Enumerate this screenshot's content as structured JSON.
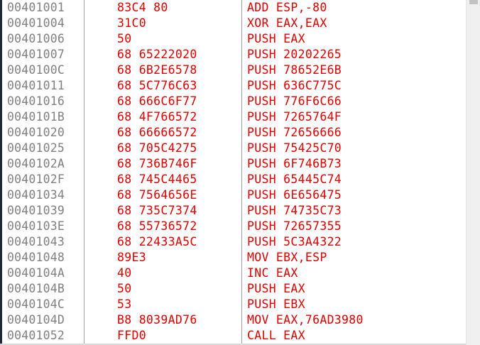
{
  "disassembly": {
    "colors": {
      "address": "#808080",
      "instruction": "#e00000",
      "separator": "#a0a0a0"
    },
    "rows": [
      {
        "address": "00401001",
        "bytes": "83C4 80",
        "instruction": "ADD ESP,-80"
      },
      {
        "address": "00401004",
        "bytes": "31C0",
        "instruction": "XOR EAX,EAX"
      },
      {
        "address": "00401006",
        "bytes": "50",
        "instruction": "PUSH EAX"
      },
      {
        "address": "00401007",
        "bytes": "68 65222020",
        "instruction": "PUSH 20202265"
      },
      {
        "address": "0040100C",
        "bytes": "68 6B2E6578",
        "instruction": "PUSH 78652E6B"
      },
      {
        "address": "00401011",
        "bytes": "68 5C776C63",
        "instruction": "PUSH 636C775C"
      },
      {
        "address": "00401016",
        "bytes": "68 666C6F77",
        "instruction": "PUSH 776F6C66"
      },
      {
        "address": "0040101B",
        "bytes": "68 4F766572",
        "instruction": "PUSH 7265764F"
      },
      {
        "address": "00401020",
        "bytes": "68 66666572",
        "instruction": "PUSH 72656666"
      },
      {
        "address": "00401025",
        "bytes": "68 705C4275",
        "instruction": "PUSH 75425C70"
      },
      {
        "address": "0040102A",
        "bytes": "68 736B746F",
        "instruction": "PUSH 6F746B73"
      },
      {
        "address": "0040102F",
        "bytes": "68 745C4465",
        "instruction": "PUSH 65445C74"
      },
      {
        "address": "00401034",
        "bytes": "68 7564656E",
        "instruction": "PUSH 6E656475"
      },
      {
        "address": "00401039",
        "bytes": "68 735C7374",
        "instruction": "PUSH 74735C73"
      },
      {
        "address": "0040103E",
        "bytes": "68 55736572",
        "instruction": "PUSH 72657355"
      },
      {
        "address": "00401043",
        "bytes": "68 22433A5C",
        "instruction": "PUSH 5C3A4322"
      },
      {
        "address": "00401048",
        "bytes": "89E3",
        "instruction": "MOV EBX,ESP"
      },
      {
        "address": "0040104A",
        "bytes": "40",
        "instruction": "INC EAX"
      },
      {
        "address": "0040104B",
        "bytes": "50",
        "instruction": "PUSH EAX"
      },
      {
        "address": "0040104C",
        "bytes": "53",
        "instruction": "PUSH EBX"
      },
      {
        "address": "0040104D",
        "bytes": "B8 8039AD76",
        "instruction": "MOV EAX,76AD3980"
      },
      {
        "address": "00401052",
        "bytes": "FFD0",
        "instruction": "CALL EAX"
      }
    ]
  }
}
